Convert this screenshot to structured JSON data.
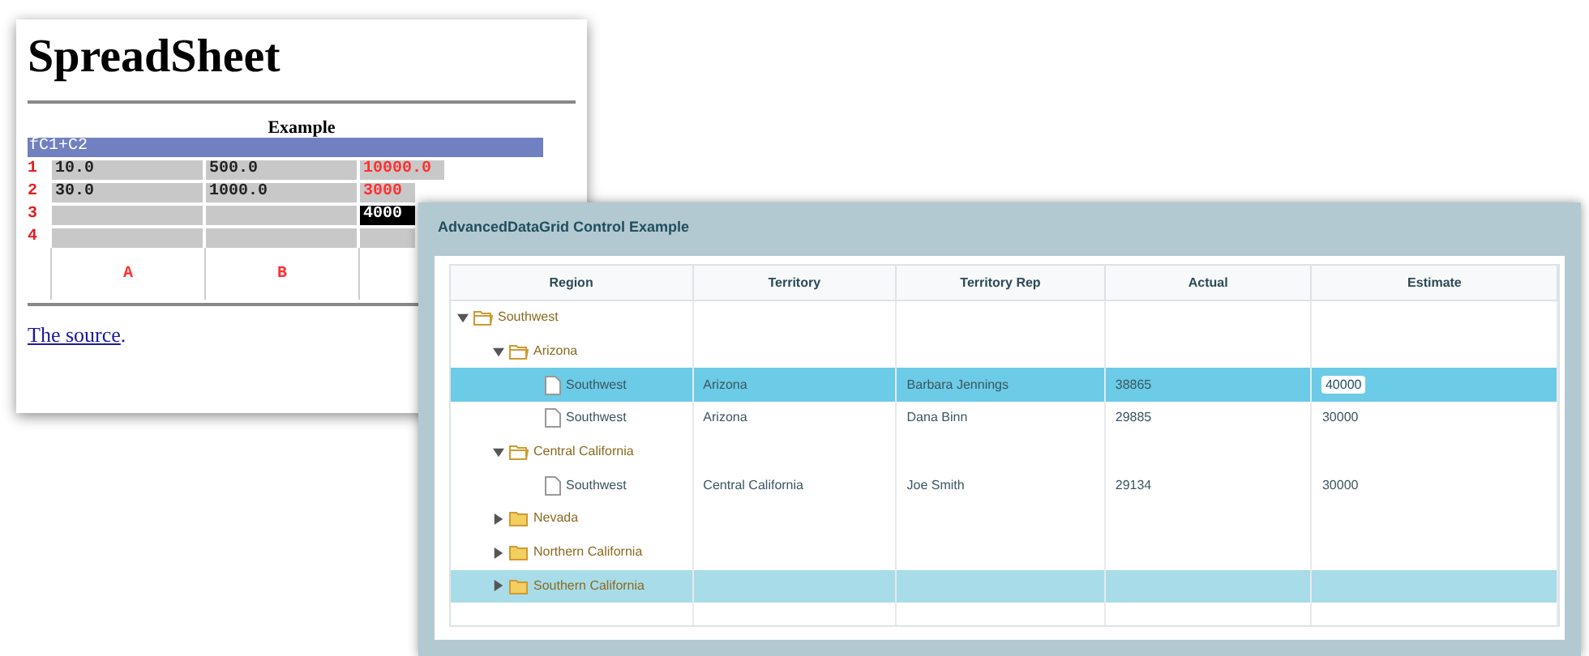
{
  "spreadsheet_window": {
    "title": "SpreadSheet",
    "caption": "Example",
    "formula": "fC1+C2",
    "rows": [
      {
        "number": "1",
        "cells": [
          {
            "text": "10.0",
            "kind": "plain",
            "selected": false
          },
          {
            "text": "500.0",
            "kind": "plain",
            "selected": false
          },
          {
            "text": "10000.0",
            "kind": "formula",
            "selected": false
          }
        ]
      },
      {
        "number": "2",
        "cells": [
          {
            "text": "30.0",
            "kind": "plain",
            "selected": false
          },
          {
            "text": "1000.0",
            "kind": "plain",
            "selected": false
          },
          {
            "text": "3000",
            "kind": "formula",
            "selected": false
          }
        ]
      },
      {
        "number": "3",
        "cells": [
          {
            "kind": "plain",
            "selected": false
          },
          {
            "kind": "plain",
            "selected": false
          },
          {
            "text": "4000",
            "kind": "plain",
            "selected": true
          }
        ]
      },
      {
        "number": "4",
        "cells": [
          {
            "kind": "plain",
            "selected": false
          },
          {
            "kind": "plain",
            "selected": false
          },
          {
            "kind": "plain",
            "selected": false
          }
        ]
      }
    ],
    "bottom_labels": [
      "A",
      "B"
    ],
    "link": "The source",
    "link_suffix": "."
  },
  "datagrid_window": {
    "title": "AdvancedDataGrid Control Example",
    "columns": [
      "Region",
      "Territory",
      "Territory Rep",
      "Actual",
      "Estimate"
    ],
    "rows": [
      {
        "kind": "folder",
        "label": "Southwest",
        "expanded": true,
        "selected": false,
        "highlighted": false,
        "children": [
          {
            "kind": "folder",
            "label": "Arizona",
            "expanded": true,
            "selected": false,
            "highlighted": false,
            "children": [
              {
                "kind": "leaf",
                "label": "Southwest",
                "territory": "Arizona",
                "rep": "Barbara Jennings",
                "actual": "38865",
                "estimate": "40000",
                "selected": true,
                "highlighted": false,
                "editing": true
              },
              {
                "kind": "leaf",
                "label": "Southwest",
                "territory": "Arizona",
                "rep": "Dana Binn",
                "actual": "29885",
                "estimate": "30000",
                "selected": false,
                "highlighted": false,
                "editing": false
              }
            ]
          },
          {
            "kind": "folder",
            "label": "Central California",
            "expanded": true,
            "selected": false,
            "highlighted": false,
            "children": [
              {
                "kind": "leaf",
                "label": "Southwest",
                "territory": "Central California",
                "rep": "Joe Smith",
                "actual": "29134",
                "estimate": "30000",
                "selected": false,
                "highlighted": false,
                "editing": false
              }
            ]
          },
          {
            "kind": "folder",
            "label": "Nevada",
            "expanded": false,
            "selected": false,
            "highlighted": false
          },
          {
            "kind": "folder",
            "label": "Northern California",
            "expanded": false,
            "selected": false,
            "highlighted": false
          },
          {
            "kind": "folder",
            "label": "Southern California",
            "expanded": false,
            "selected": false,
            "highlighted": true
          }
        ]
      }
    ]
  }
}
